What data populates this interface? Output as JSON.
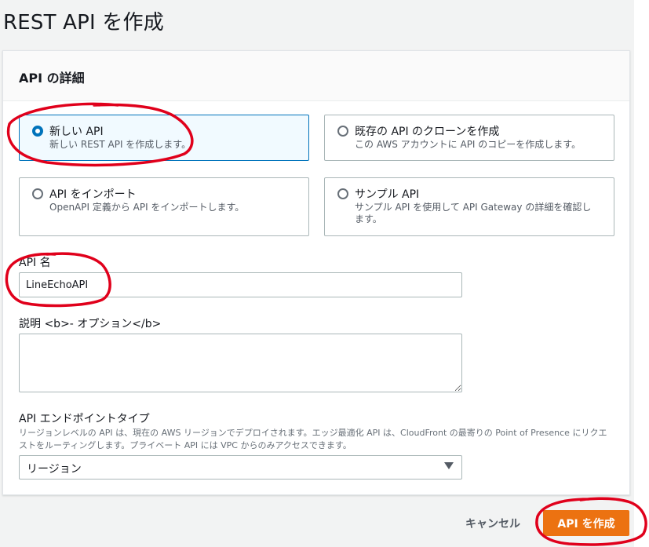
{
  "page": {
    "title": "REST API を作成"
  },
  "panel": {
    "title": "API の詳細"
  },
  "options": [
    {
      "label": "新しい API",
      "desc": "新しい REST API を作成します。",
      "selected": true
    },
    {
      "label": "既存の API のクローンを作成",
      "desc": "この AWS アカウントに API のコピーを作成します。",
      "selected": false
    },
    {
      "label": "API をインポート",
      "desc": "OpenAPI 定義から API をインポートします。",
      "selected": false
    },
    {
      "label": "サンプル API",
      "desc": "サンプル API を使用して API Gateway の詳細を確認します。",
      "selected": false
    }
  ],
  "api_name": {
    "label": "API 名",
    "value": "LineEchoAPI"
  },
  "description": {
    "label": "説明 <b>- オプション</b>",
    "value": ""
  },
  "endpoint": {
    "label": "API エンドポイントタイプ",
    "help": "リージョンレベルの API は、現在の AWS リージョンでデプロイされます。エッジ最適化 API は、CloudFront の最寄りの Point of Presence にリクエストをルーティングします。プライベート API には VPC からのみアクセスできます。",
    "selected": "リージョン"
  },
  "actions": {
    "cancel": "キャンセル",
    "create": "API を作成"
  },
  "colors": {
    "accent": "#0073bb",
    "primary_button": "#ec7211",
    "annotation": "#e0001b"
  }
}
